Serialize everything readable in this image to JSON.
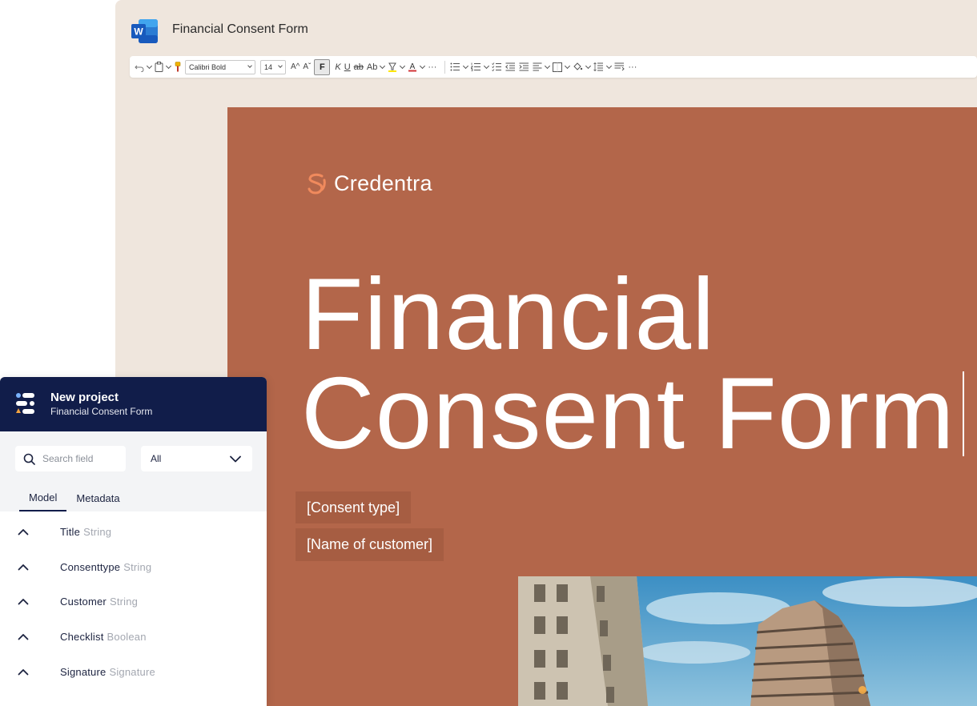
{
  "word": {
    "app_icon": "word-icon",
    "app_icon_letter": "W",
    "document_title": "Financial Consent Form",
    "ribbon": {
      "font_name": "Calibri Bold",
      "font_size": "14",
      "bold_label": "F",
      "italic_label": "K",
      "underline_label": "U",
      "strike_label": "ab",
      "case_label": "Ab",
      "more_label": "···",
      "grow_label": "A^",
      "shrink_label": "Aˇ",
      "font_color_label": "A"
    }
  },
  "document": {
    "brand_name": "Credentra",
    "title_line1": "Financial",
    "title_line2": "Consent Form",
    "placeholder_consent_type": "[Consent type]",
    "placeholder_customer": "[Name of customer]",
    "colors": {
      "page": "#b3664a",
      "placeholder_bg": "#a65d42",
      "brand_mark": "#f08a5d"
    }
  },
  "panel": {
    "title": "New project",
    "subtitle": "Financial Consent Form",
    "search_placeholder": "Search field",
    "filter_value": "All",
    "tabs": [
      {
        "label": "Model",
        "active": true
      },
      {
        "label": "Metadata",
        "active": false
      }
    ],
    "fields": [
      {
        "name": "Title",
        "type": "String"
      },
      {
        "name": "Consenttype",
        "type": "String"
      },
      {
        "name": "Customer",
        "type": "String"
      },
      {
        "name": "Checklist",
        "type": "Boolean"
      },
      {
        "name": "Signature",
        "type": "Signature"
      }
    ],
    "colors": {
      "header": "#111d4a",
      "controls_bg": "#f3f4f6"
    }
  }
}
